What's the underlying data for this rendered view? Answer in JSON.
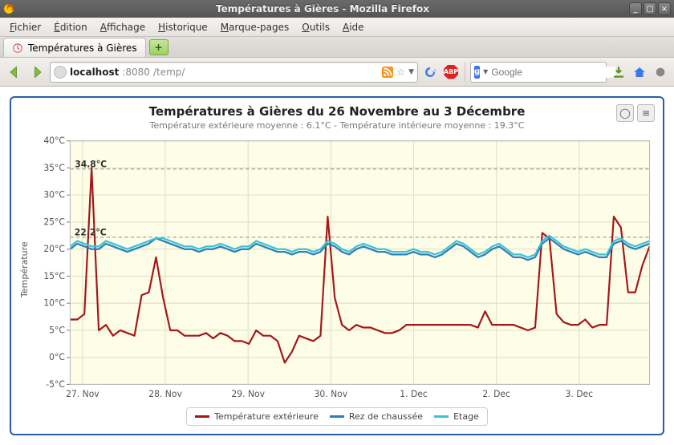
{
  "window": {
    "title": "Températures à Gières - Mozilla Firefox",
    "min": "_",
    "max": "▢",
    "close": "×"
  },
  "menubar": [
    "Fichier",
    "Édition",
    "Affichage",
    "Historique",
    "Marque-pages",
    "Outils",
    "Aide"
  ],
  "tabs": {
    "active_label": "Températures à Gières"
  },
  "url": {
    "host": "localhost",
    "port": ":8080",
    "path": "/temp/"
  },
  "search": {
    "placeholder": "Google"
  },
  "chart_data": {
    "type": "line",
    "title": "Températures à Gières du 26 Novembre au 3 Décembre",
    "subtitle": "Température extérieure moyenne : 6.1°C - Température intérieure moyenne : 19.3°C",
    "ylabel": "Température",
    "xlabel": "",
    "ylim": [
      -5,
      40
    ],
    "yticks": [
      "-5°C",
      "0°C",
      "5°C",
      "10°C",
      "15°C",
      "20°C",
      "25°C",
      "30°C",
      "35°C",
      "40°C"
    ],
    "x_categories": [
      "27. Nov",
      "28. Nov",
      "29. Nov",
      "30. Nov",
      "1. Dec",
      "2. Dec",
      "3. Dec"
    ],
    "annotations": [
      {
        "text": "34.8°C",
        "x": 0.65,
        "y": 34.8
      },
      {
        "text": "22.2°C",
        "x": 0.6,
        "y": 22.2
      }
    ],
    "plot_lines": [
      {
        "y": 34.8,
        "style": "dash"
      },
      {
        "y": 22.2,
        "style": "dash"
      }
    ],
    "series": [
      {
        "name": "Température extérieure",
        "color": "#a31717",
        "values": [
          7,
          7,
          8,
          35,
          5,
          6,
          4,
          5,
          4.5,
          4,
          11.5,
          12,
          18.5,
          11,
          5,
          5,
          4,
          4,
          4,
          4.5,
          3.5,
          4.5,
          4,
          3,
          3,
          2.5,
          5,
          4,
          4,
          3,
          -1,
          1,
          4,
          3.5,
          3,
          4,
          26,
          11,
          6,
          5,
          6,
          5.5,
          5.5,
          5,
          4.5,
          4.5,
          5,
          6,
          6,
          6,
          6,
          6,
          6,
          6,
          6,
          6,
          6,
          5.5,
          8.5,
          6,
          6,
          6,
          6,
          5.5,
          5,
          5.5,
          23,
          22,
          8,
          6.5,
          6,
          6,
          7,
          5.5,
          6,
          6,
          26,
          24,
          12,
          12,
          17,
          20.5
        ]
      },
      {
        "name": "Rez de chaussée",
        "color": "#2a7fb8",
        "values": [
          20,
          21,
          20.5,
          20,
          20,
          21,
          20.5,
          20,
          19.5,
          20,
          20.5,
          21,
          22,
          21.5,
          21,
          20.5,
          20,
          20,
          19.5,
          20,
          20,
          20.5,
          20,
          19.5,
          20,
          20,
          21,
          20.5,
          20,
          19.5,
          19.5,
          19,
          19.5,
          19.5,
          19,
          19.5,
          21,
          20.5,
          19.5,
          19,
          20,
          20.5,
          20,
          19.5,
          19.5,
          19,
          19,
          19,
          19.5,
          19,
          19,
          18.5,
          19,
          20,
          21,
          20.5,
          19.5,
          18.5,
          19,
          20,
          20.5,
          19.5,
          18.5,
          18.5,
          18,
          18.5,
          21,
          22,
          21,
          20,
          19.5,
          19,
          19.5,
          19,
          18.5,
          18.5,
          21,
          21.5,
          20.5,
          20,
          20.5,
          21
        ]
      },
      {
        "name": "Etage",
        "color": "#3cc1d6",
        "values": [
          20.5,
          21.5,
          21,
          20.5,
          20.5,
          21.5,
          21,
          20.5,
          20,
          20.5,
          21,
          21.5,
          22,
          22,
          21.5,
          21,
          20.5,
          20.5,
          20,
          20.5,
          20.5,
          21,
          20.5,
          20,
          20.5,
          20.5,
          21.5,
          21,
          20.5,
          20,
          20,
          19.5,
          20,
          20,
          19.5,
          20,
          21.5,
          21,
          20,
          19.5,
          20.5,
          21,
          20.5,
          20,
          20,
          19.5,
          19.5,
          19.5,
          20,
          19.5,
          19.5,
          19,
          19.5,
          20.5,
          21.5,
          21,
          20,
          19,
          19.5,
          20.5,
          21,
          20,
          19,
          19,
          18.5,
          19,
          21.5,
          22.5,
          21.5,
          20.5,
          20,
          19.5,
          20,
          19.5,
          19,
          19,
          21.5,
          22,
          21,
          20.5,
          21,
          21.5
        ]
      }
    ]
  }
}
